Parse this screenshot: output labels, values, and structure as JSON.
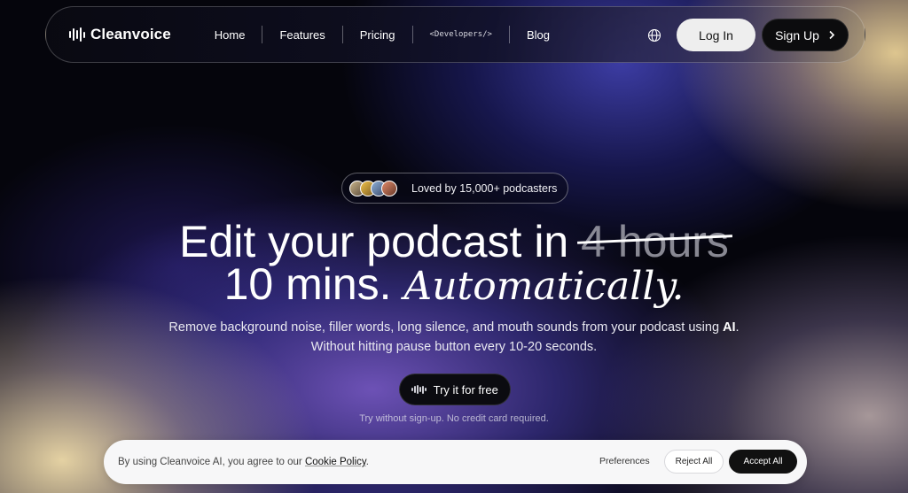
{
  "nav": {
    "brand": "Cleanvoice",
    "links": [
      "Home",
      "Features",
      "Pricing",
      "<Developers/>",
      "Blog"
    ],
    "login_label": "Log In",
    "signup_label": "Sign Up"
  },
  "hero": {
    "badge_text": "Loved by 15,000+ podcasters",
    "headline_part1": "Edit your podcast in ",
    "headline_struck": "4 hours",
    "headline_part2": "10 mins. ",
    "headline_italic": "Automatically.",
    "subtitle_line1_prefix": "Remove background noise, filler words, long silence, and mouth sounds from your podcast using ",
    "subtitle_line1_bold": "AI",
    "subtitle_line1_suffix": ".",
    "subtitle_line2": "Without hitting pause button every 10-20 seconds.",
    "cta_label": "Try it for free",
    "note": "Try without sign-up. No credit card required."
  },
  "cookie": {
    "text_prefix": "By using Cleanvoice AI, you agree to our ",
    "policy_link": "Cookie Policy",
    "text_suffix": ".",
    "preferences_label": "Preferences",
    "reject_label": "Reject All",
    "accept_label": "Accept All"
  },
  "icons": {
    "brand_logo": "waveform-icon",
    "language": "globe-icon",
    "signup_arrow": "chevron-right-icon",
    "cta": "waveform-icon"
  }
}
